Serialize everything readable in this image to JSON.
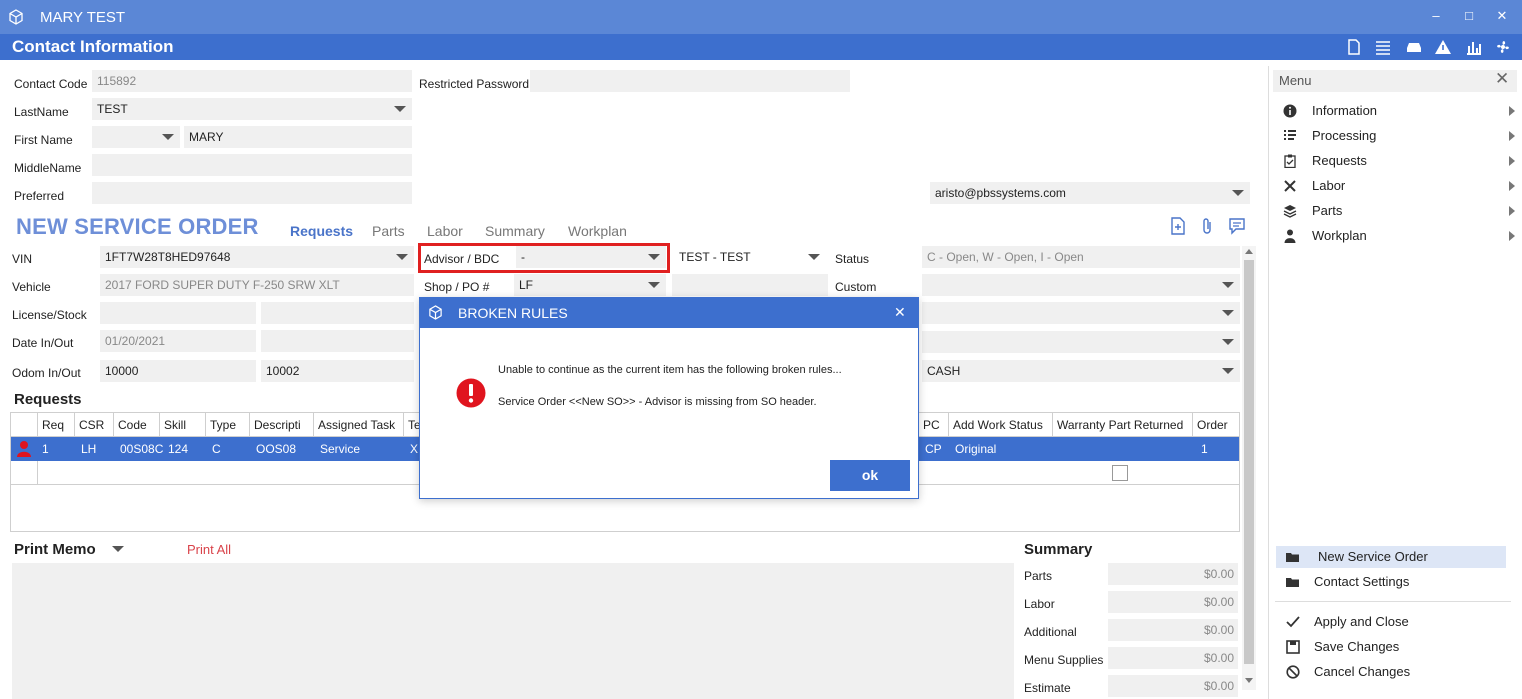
{
  "window": {
    "title": "MARY TEST"
  },
  "header": {
    "title": "Contact Information"
  },
  "contact": {
    "code_label": "Contact Code",
    "code_value": "115892",
    "restricted_label": "Restricted Password",
    "restricted_value": "",
    "lastname_label": "LastName",
    "lastname_value": "TEST",
    "firstname_label": "First Name",
    "firstname_value": "MARY",
    "middlename_label": "MiddleName",
    "middlename_value": "",
    "preferred_label": "Preferred",
    "preferred_value": "",
    "email_value": "aristo@pbssystems.com"
  },
  "service_order": {
    "title": "NEW SERVICE ORDER",
    "tabs": [
      "Requests",
      "Parts",
      "Labor",
      "Summary",
      "Workplan"
    ],
    "vin_label": "VIN",
    "vin_value": "1FT7W28T8HED97648",
    "vehicle_label": "Vehicle",
    "vehicle_value": "2017 FORD SUPER DUTY F-250 SRW XLT",
    "license_label": "License/Stock",
    "datein_label": "Date In/Out",
    "datein_value": "01/20/2021",
    "odom_label": "Odom In/Out",
    "odom_in": "10000",
    "odom_out": "10002",
    "advisor_label": "Advisor / BDC",
    "advisor_value": "-",
    "advisor_bdc": "TEST - TEST",
    "shop_label": "Shop / PO #",
    "shop_value": "LF",
    "status_label": "Status",
    "status_value": "C - Open, W - Open, I - Open",
    "custom_label": "Custom",
    "pay_value": "CASH"
  },
  "requests": {
    "title": "Requests",
    "columns": [
      "Req",
      "CSR",
      "Code",
      "Skill",
      "Type",
      "Descripti",
      "Assigned Task",
      "Te",
      "PC",
      "Add Work Status",
      "Warranty Part Returned",
      "Order"
    ],
    "row": {
      "req": "1",
      "csr": "LH",
      "code": "00S08C",
      "skill": "124",
      "type": "C",
      "desc": "OOS08",
      "task": "Service",
      "te": "X",
      "pc": "CP",
      "status": "Original",
      "order": "1"
    }
  },
  "memo": {
    "title": "Print Memo",
    "print_all": "Print All"
  },
  "summary": {
    "title": "Summary",
    "rows": [
      {
        "label": "Parts",
        "value": "$0.00"
      },
      {
        "label": "Labor",
        "value": "$0.00"
      },
      {
        "label": "Additional",
        "value": "$0.00"
      },
      {
        "label": "Menu Supplies",
        "value": "$0.00"
      },
      {
        "label": "Estimate",
        "value": "$0.00"
      }
    ]
  },
  "menu": {
    "title": "Menu",
    "items": [
      {
        "label": "Information",
        "icon": "info-icon"
      },
      {
        "label": "Processing",
        "icon": "processing-icon"
      },
      {
        "label": "Requests",
        "icon": "clipboard-icon"
      },
      {
        "label": "Labor",
        "icon": "tools-icon"
      },
      {
        "label": "Parts",
        "icon": "stack-icon"
      },
      {
        "label": "Workplan",
        "icon": "person-icon"
      }
    ],
    "actions": [
      {
        "label": "New Service Order",
        "icon": "folder-icon"
      },
      {
        "label": "Contact Settings",
        "icon": "folder-icon"
      }
    ],
    "footer": [
      {
        "label": "Apply and Close",
        "icon": "check-icon"
      },
      {
        "label": "Save Changes",
        "icon": "save-icon"
      },
      {
        "label": "Cancel Changes",
        "icon": "cancel-icon"
      }
    ]
  },
  "dialog": {
    "title": "BROKEN RULES",
    "line1": "Unable to continue as the current item has the following broken rules...",
    "line2": "Service Order <<New SO>> - Advisor is missing from SO header.",
    "ok_label": "ok"
  },
  "colors": {
    "accent": "#3d6fce",
    "titlebar": "#5b87d6",
    "highlight_border": "#e02020",
    "error": "#e0141e",
    "link": "#d9434a"
  }
}
